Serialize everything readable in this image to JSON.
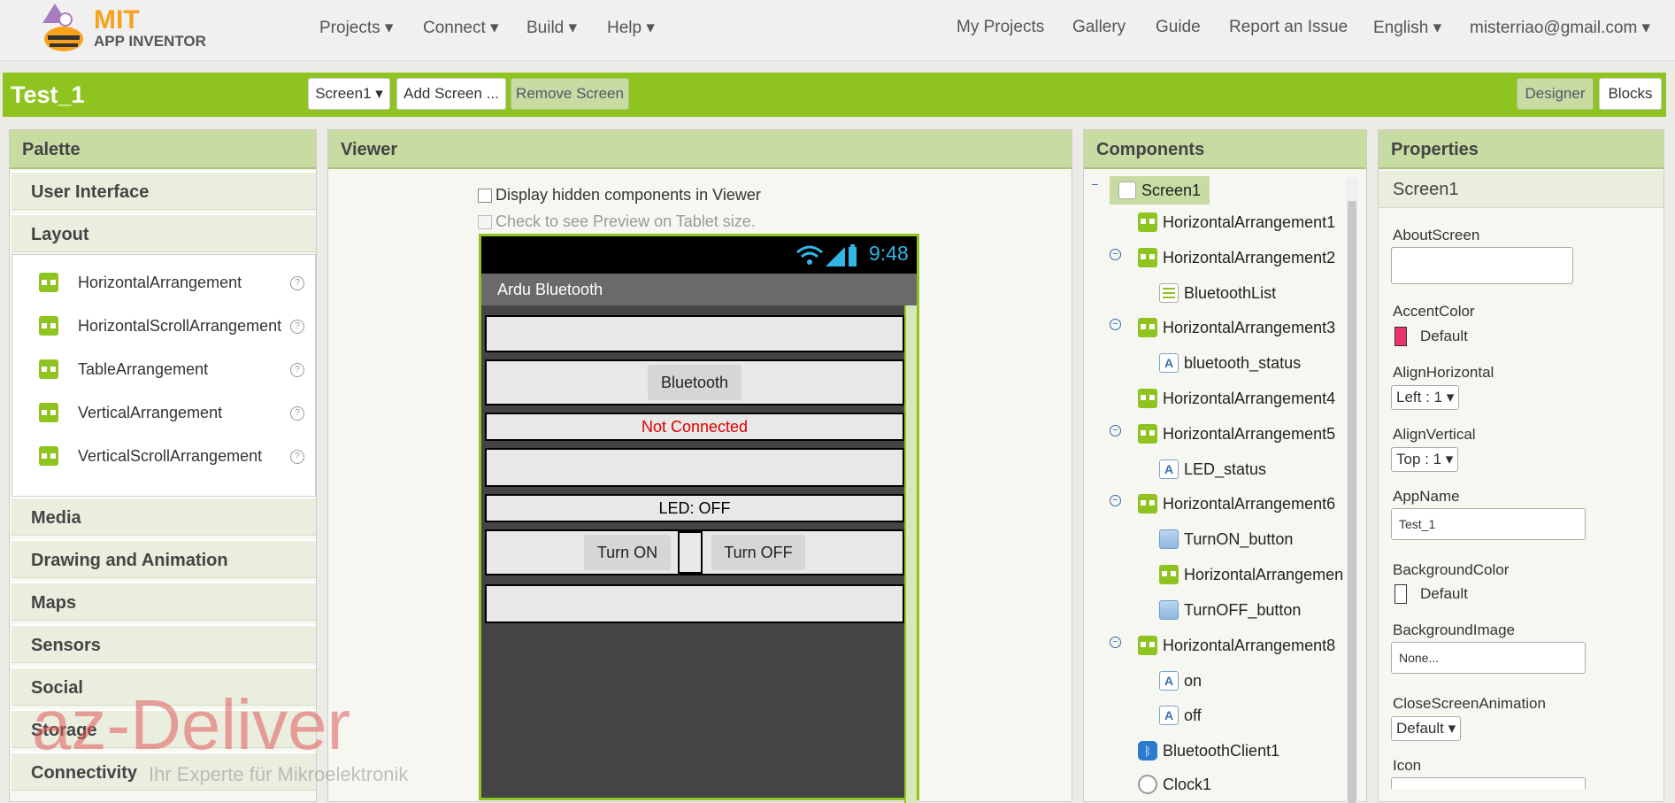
{
  "brand": {
    "line1": "MIT",
    "line2": "APP INVENTOR"
  },
  "nav_left": [
    "Projects ▾",
    "Connect ▾",
    "Build ▾",
    "Help ▾"
  ],
  "nav_right": [
    "My Projects",
    "Gallery",
    "Guide",
    "Report an Issue",
    "English ▾",
    "misterriao@gmail.com ▾"
  ],
  "toolbar": {
    "project_name": "Test_1",
    "screen_select": "Screen1 ▾",
    "add_screen": "Add Screen ...",
    "remove_screen": "Remove Screen",
    "designer": "Designer",
    "blocks": "Blocks"
  },
  "palette": {
    "title": "Palette",
    "categories": [
      "User Interface",
      "Layout",
      "Media",
      "Drawing and Animation",
      "Maps",
      "Sensors",
      "Social",
      "Storage",
      "Connectivity"
    ],
    "layout_items": [
      "HorizontalArrangement",
      "HorizontalScrollArrangement",
      "TableArrangement",
      "VerticalArrangement",
      "VerticalScrollArrangement"
    ],
    "help_glyph": "?"
  },
  "viewer": {
    "title": "Viewer",
    "hidden_checkbox": "Display hidden components in Viewer",
    "tablet_checkbox": "Check to see Preview on Tablet size.",
    "time": "9:48",
    "app_title": "Ardu Bluetooth",
    "bluetooth_button": "Bluetooth",
    "status_text": "Not Connected",
    "led_text": "LED: OFF",
    "turn_on": "Turn ON",
    "turn_off": "Turn OFF"
  },
  "components": {
    "title": "Components",
    "items": [
      "Screen1",
      "HorizontalArrangement1",
      "HorizontalArrangement2",
      "BluetoothList",
      "HorizontalArrangement3",
      "bluetooth_status",
      "HorizontalArrangement4",
      "HorizontalArrangement5",
      "LED_status",
      "HorizontalArrangement6",
      "TurnON_button",
      "HorizontalArrangemen",
      "TurnOFF_button",
      "HorizontalArrangement8",
      "on",
      "off",
      "BluetoothClient1",
      "Clock1"
    ],
    "label_glyph": "A",
    "collapse_glyph": "−"
  },
  "properties": {
    "title": "Properties",
    "selected": "Screen1",
    "about_screen": "AboutScreen",
    "accent_color": "AccentColor",
    "accent_value": "Default",
    "align_horizontal": "AlignHorizontal",
    "align_horizontal_value": "Left : 1 ▾",
    "align_vertical": "AlignVertical",
    "align_vertical_value": "Top : 1 ▾",
    "app_name": "AppName",
    "app_name_value": "Test_1",
    "background_color": "BackgroundColor",
    "background_color_value": "Default",
    "background_image": "BackgroundImage",
    "background_image_value": "None...",
    "close_screen_animation": "CloseScreenAnimation",
    "close_screen_animation_value": "Default ▾",
    "icon": "Icon"
  },
  "watermark": {
    "brand": "az-Deliver",
    "tagline": "Ihr Experte für Mikroelektronik"
  },
  "colors": {
    "accent_green": "#8fc31f",
    "accent_swatch": "#e8336d",
    "status_red": "#e00000"
  }
}
